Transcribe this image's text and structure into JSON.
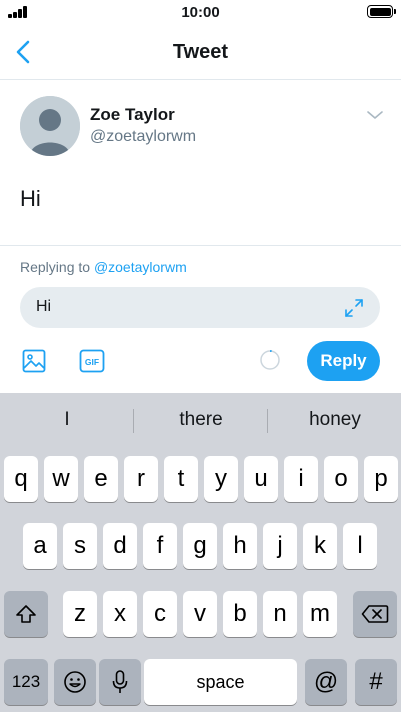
{
  "status_bar": {
    "time": "10:00",
    "signal_icon": "cellular-signal-icon",
    "battery_icon": "battery-full-icon"
  },
  "nav": {
    "title": "Tweet",
    "back_icon": "chevron-left-icon"
  },
  "tweet": {
    "author_name": "Zoe Taylor",
    "author_handle": "@zoetaylorwm",
    "text": "Hi",
    "menu_icon": "chevron-down-icon"
  },
  "reply": {
    "replying_label": "Replying to",
    "replying_handle": "@zoetaylorwm",
    "input_value": "Hi",
    "expand_icon": "expand-arrows-icon",
    "image_icon": "image-icon",
    "gif_icon": "gif-icon",
    "gif_label": "GIF",
    "button_label": "Reply"
  },
  "keyboard": {
    "suggestions": [
      "I",
      "there",
      "honey"
    ],
    "row1": [
      "q",
      "w",
      "e",
      "r",
      "t",
      "y",
      "u",
      "i",
      "o",
      "p"
    ],
    "row2": [
      "a",
      "s",
      "d",
      "f",
      "g",
      "h",
      "j",
      "k",
      "l"
    ],
    "row3": [
      "z",
      "x",
      "c",
      "v",
      "b",
      "n",
      "m"
    ],
    "numbers_label": "123",
    "space_label": "space",
    "at_label": "@",
    "hash_label": "#",
    "shift_icon": "shift-icon",
    "delete_icon": "backspace-icon",
    "emoji_icon": "emoji-icon",
    "mic_icon": "microphone-icon"
  },
  "colors": {
    "accent": "#1da1f2",
    "muted_text": "#657786",
    "input_bg": "#e6ecf0",
    "keyboard_bg": "#d1d4da"
  }
}
